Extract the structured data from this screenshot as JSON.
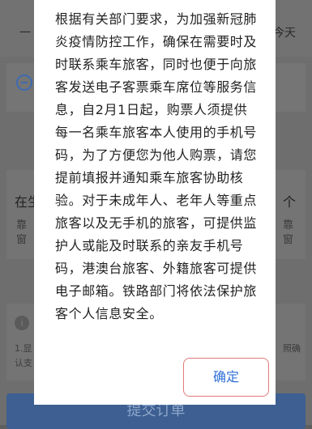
{
  "background": {
    "top_left": "一",
    "top_right": "今天",
    "left_title": "在生",
    "right_title": "个",
    "left_sub": "靠窗",
    "right_sub": "靠窗",
    "note_left": "1.显\n认支",
    "note_right": "照确",
    "info_icon": "i",
    "submit_label": "提交订单"
  },
  "dialog": {
    "notice": "根据有关部门要求，为加强新冠肺炎疫情防控工作，确保在需要时及时联系乘车旅客，同时也便于向旅客发送电子客票乘车席位等服务信息，自2月1日起，购票人须提供每一名乘车旅客本人使用的手机号码，为了方便您为他人购票，请您提前填报并通知乘车旅客协助核验。对于未成年人、老年人等重点旅客以及无手机的旅客，可提供监护人或能及时联系的亲友手机号码，港澳台旅客、外籍旅客可提供电子邮箱。铁路部门将依法保护旅客个人信息安全。",
    "confirm_label": "确定"
  },
  "colors": {
    "overlay": "#6e6e6e",
    "dialog_bg": "#ffffff",
    "confirm_text": "#2f6fd6",
    "confirm_border": "#e07a7a",
    "submit_bg": "#3d5f92"
  }
}
